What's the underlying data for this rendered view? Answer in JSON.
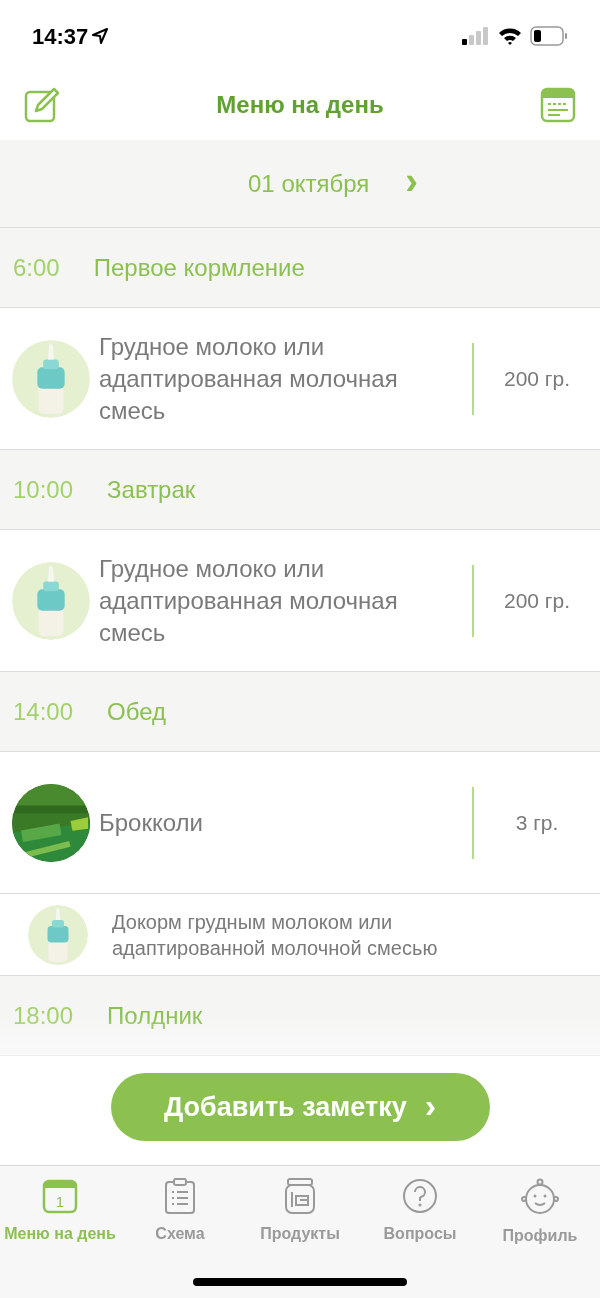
{
  "status_bar": {
    "time": "14:37"
  },
  "header": {
    "title": "Меню на день"
  },
  "date_bar": {
    "date": "01 октября",
    "next": "›"
  },
  "meals": [
    {
      "time": "6:00",
      "name": "Первое кормление",
      "items": [
        {
          "kind": "milk",
          "name": "Грудное молоко или адаптированная молочная смесь",
          "amount": "200 гр."
        }
      ]
    },
    {
      "time": "10:00",
      "name": "Завтрак",
      "items": [
        {
          "kind": "milk",
          "name": "Грудное молоко или адаптированная молочная смесь",
          "amount": "200 гр."
        }
      ]
    },
    {
      "time": "14:00",
      "name": "Обед",
      "items": [
        {
          "kind": "product",
          "name": "Брокколи",
          "amount": "3 гр."
        },
        {
          "kind": "note",
          "name": "Докорм грудным молоком или адаптированной молочной смесью"
        }
      ]
    },
    {
      "time": "18:00",
      "name": "Полдник"
    }
  ],
  "add_button": {
    "label": "Добавить заметку",
    "chevron": "›"
  },
  "tab_bar": [
    {
      "label": "Меню на день",
      "icon_text": "1",
      "selected": true
    },
    {
      "label": "Схема",
      "selected": false
    },
    {
      "label": "Продукты",
      "selected": false
    },
    {
      "label": "Вопросы",
      "selected": false
    },
    {
      "label": "Профиль",
      "selected": false
    }
  ]
}
